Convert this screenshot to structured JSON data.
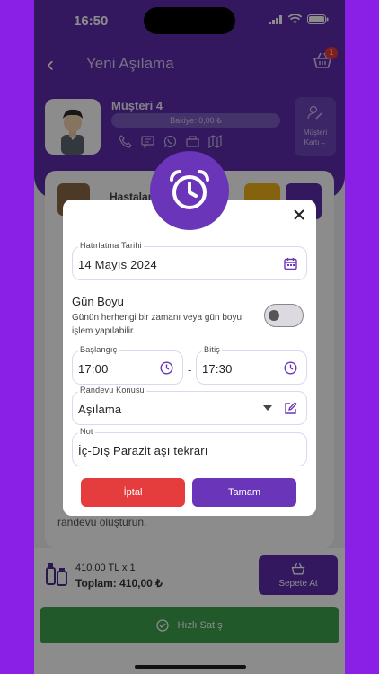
{
  "status_bar": {
    "time": "16:50"
  },
  "nav": {
    "title": "Yeni Aşılama",
    "cart_badge": "1"
  },
  "customer": {
    "name": "Müşteri 4",
    "balance": "Bakiye: 0,00 ₺",
    "card_button": "Müşteri Kartı→"
  },
  "background": {
    "pet_name": "Hastalar",
    "reminder_text": "randevu oluşturun."
  },
  "bottom_bar": {
    "price": "410.00 TL x 1",
    "total": "Toplam: 410,00 ₺",
    "add_to_cart": "Sepete At",
    "quick_sale": "Hızlı Satış"
  },
  "dialog": {
    "reminder_date": {
      "label": "Hatırlatma Tarihi",
      "value": "14 Mayıs 2024"
    },
    "all_day": {
      "title": "Gün Boyu",
      "description": "Günün herhengi bir zamanı veya gün boyu işlem yapılabilir.",
      "enabled": false
    },
    "start": {
      "label": "Başlangıç",
      "value": "17:00"
    },
    "end": {
      "label": "Bitiş",
      "value": "17:30"
    },
    "separator": "-",
    "subject": {
      "label": "Randevu Konusu",
      "value": "Aşılama"
    },
    "note": {
      "label": "Not",
      "value": "İç-Dış Parazit aşı tekrarı"
    },
    "cancel_label": "İptal",
    "ok_label": "Tamam"
  },
  "colors": {
    "primary": "#5e2db0",
    "danger": "#e53d3d",
    "success": "#3fa34d",
    "outer_bg": "#8a1fe6"
  }
}
